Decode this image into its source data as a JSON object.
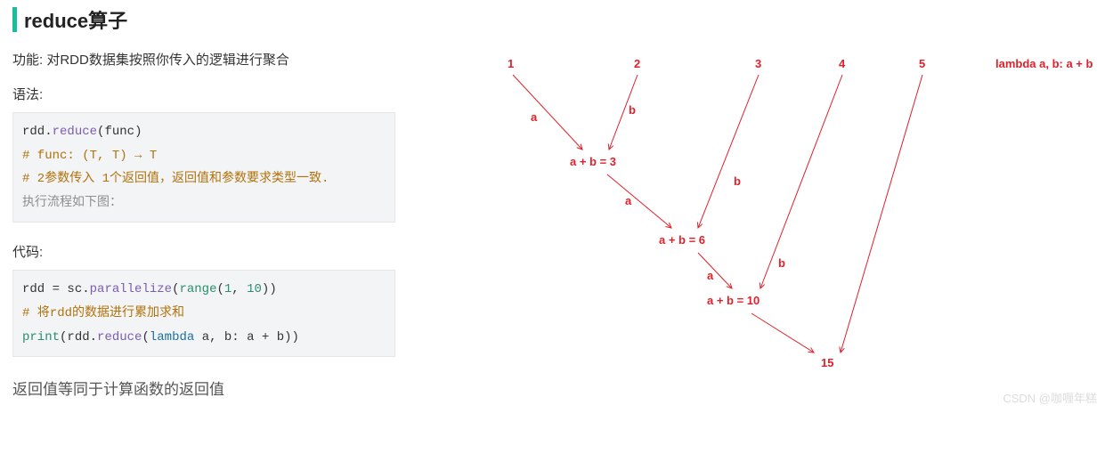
{
  "heading": "reduce算子",
  "description": "功能: 对RDD数据集按照你传入的逻辑进行聚合",
  "syntax_label": "语法:",
  "code1": {
    "line1": {
      "obj": "rdd",
      "dot": ".",
      "fn": "reduce",
      "open": "(",
      "arg": "func",
      "close": ")"
    },
    "line2": "# func:  (T, T) → T",
    "line3": "# 2参数传入 1个返回值，返回值和参数要求类型一致.",
    "line4": "执行流程如下图："
  },
  "code_label": "代码:",
  "code2": {
    "line1": {
      "lhs": "rdd ",
      "eq": "=",
      "sp": " ",
      "obj": "sc",
      "dot": ".",
      "fn": "parallelize",
      "open": "(",
      "range": "range",
      "ropen": "(",
      "n1": "1",
      "comma": ", ",
      "n2": "10",
      "rclose": ")",
      "close": ")"
    },
    "line2": "# 将rdd的数据进行累加求和",
    "line3": {
      "print": "print",
      "open": "(",
      "obj": "rdd",
      "dot": ".",
      "fn": "reduce",
      "ropen": "(",
      "lam": "lambda",
      "args": " a, b: a ",
      "plus": "+",
      "tail": " b",
      "rclose": ")",
      "close": ")"
    }
  },
  "footer": "返回值等同于计算函数的返回值",
  "watermark": "CSDN @咖喱年糕",
  "diagram": {
    "inputs": {
      "n1": "1",
      "n2": "2",
      "n3": "3",
      "n4": "4",
      "n5": "5"
    },
    "lambda": "lambda a, b: a + b",
    "labels": {
      "a": "a",
      "b": "b"
    },
    "steps": {
      "s1": "a + b = 3",
      "s2": "a + b = 6",
      "s3": "a + b = 10",
      "final": "15"
    }
  }
}
